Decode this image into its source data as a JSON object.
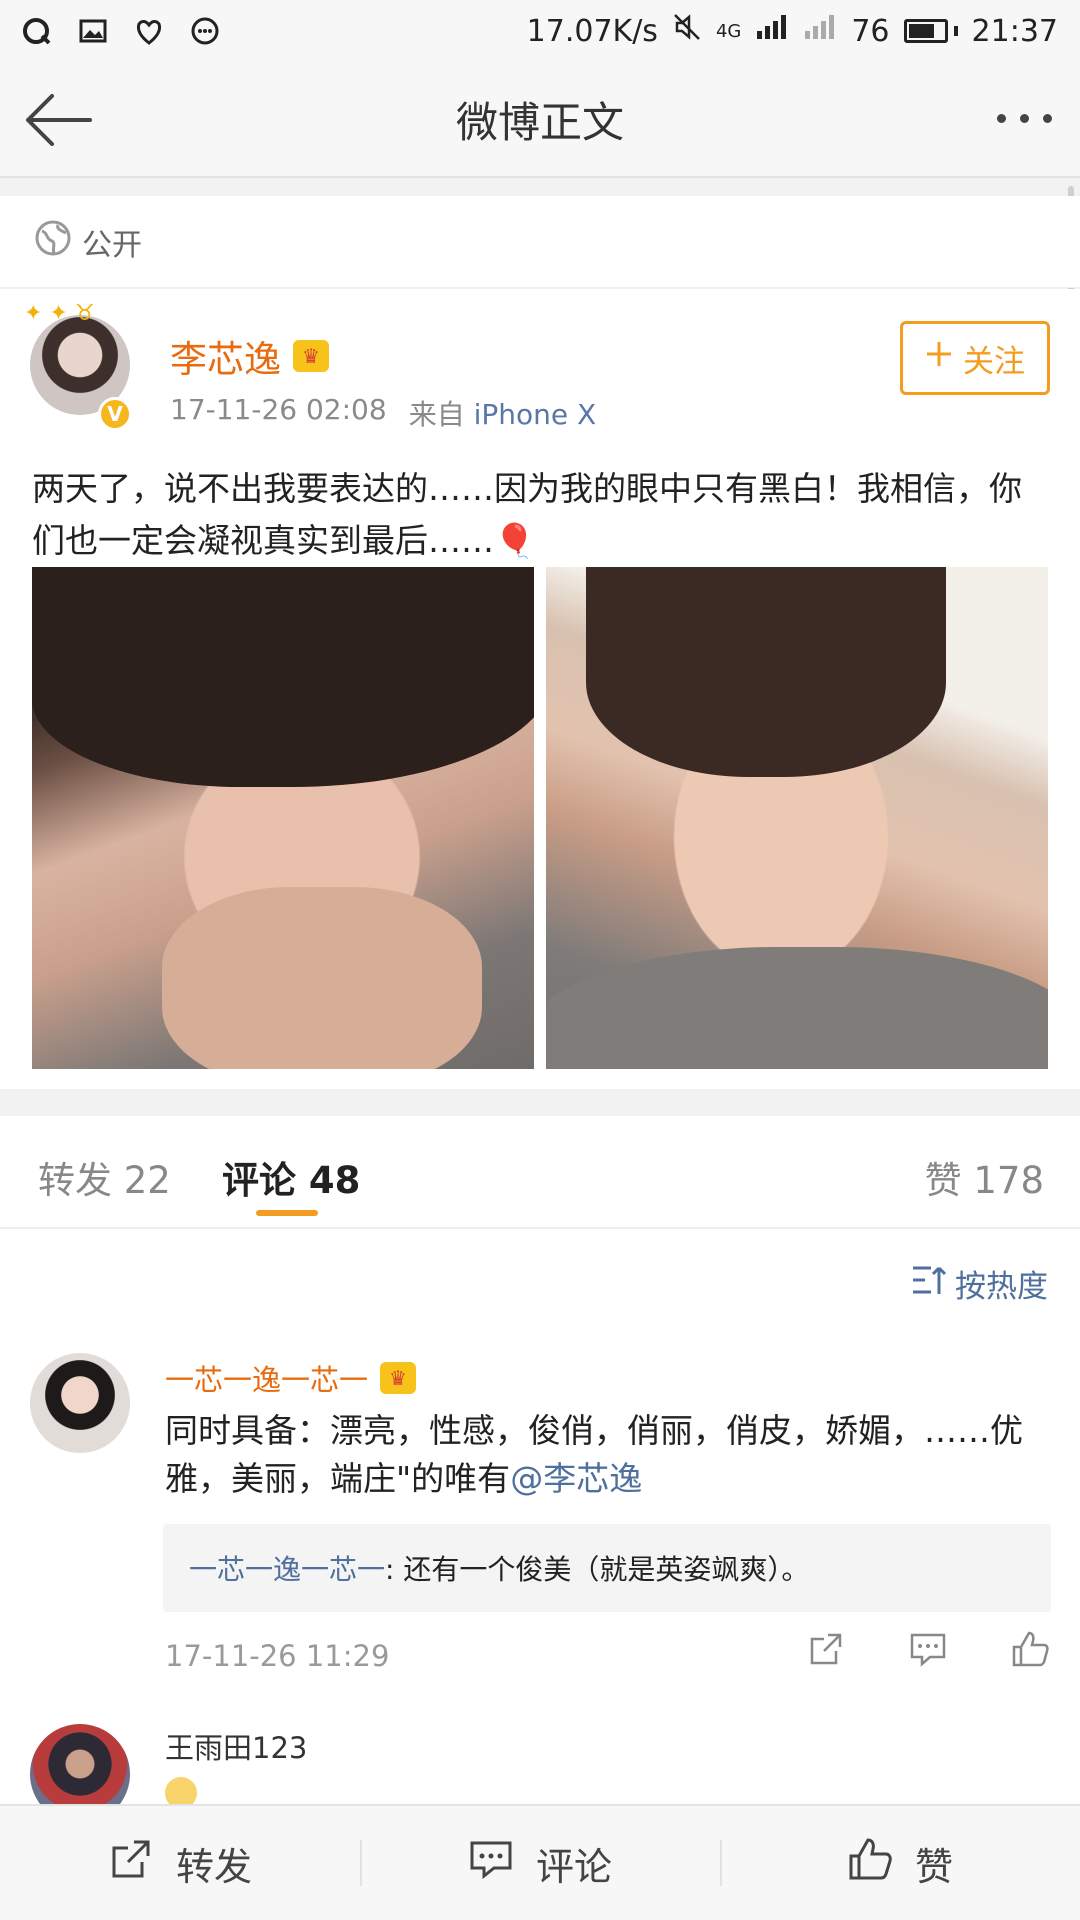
{
  "status_bar": {
    "speed": "17.07K/s",
    "network": "4G",
    "battery": "76",
    "battery_level": 0.76,
    "time": "21:37"
  },
  "nav": {
    "title": "微博正文",
    "back_icon": "arrow-left-icon",
    "more_icon": "more-dots-icon"
  },
  "visibility": {
    "label": "公开",
    "icon": "globe-icon"
  },
  "post": {
    "username": "李芯逸",
    "time": "17-11-26 02:08",
    "source_prefix": "来自",
    "source": "iPhone X",
    "follow_label": "关注",
    "text": "两天了，说不出我要表达的……因为我的眼中只有黑白！我相信，你们也一定会凝视真实到最后……🎈",
    "photos": [
      "photo-1",
      "photo-2"
    ]
  },
  "tabs": {
    "repost": "转发 22",
    "comment": "评论 48",
    "like": "赞 178"
  },
  "comments": {
    "sort_label": "按热度",
    "items": [
      {
        "user": "一芯一逸一芯一",
        "text": "同时具备：漂亮，性感，俊俏，俏丽，俏皮，娇媚，……优雅，美丽，端庄\"的唯有",
        "mention": "@李芯逸",
        "reply_user": "一芯一逸一芯一",
        "reply_text": ": 还有一个俊美（就是英姿飒爽）。",
        "time": "17-11-26 11:29"
      },
      {
        "user": "王雨田123"
      }
    ]
  },
  "bottom_bar": {
    "repost": "转发",
    "comment": "评论",
    "like": "赞"
  },
  "colors": {
    "accent": "#f39c1f",
    "username": "#e86c0f",
    "link": "#4f6f9d"
  }
}
